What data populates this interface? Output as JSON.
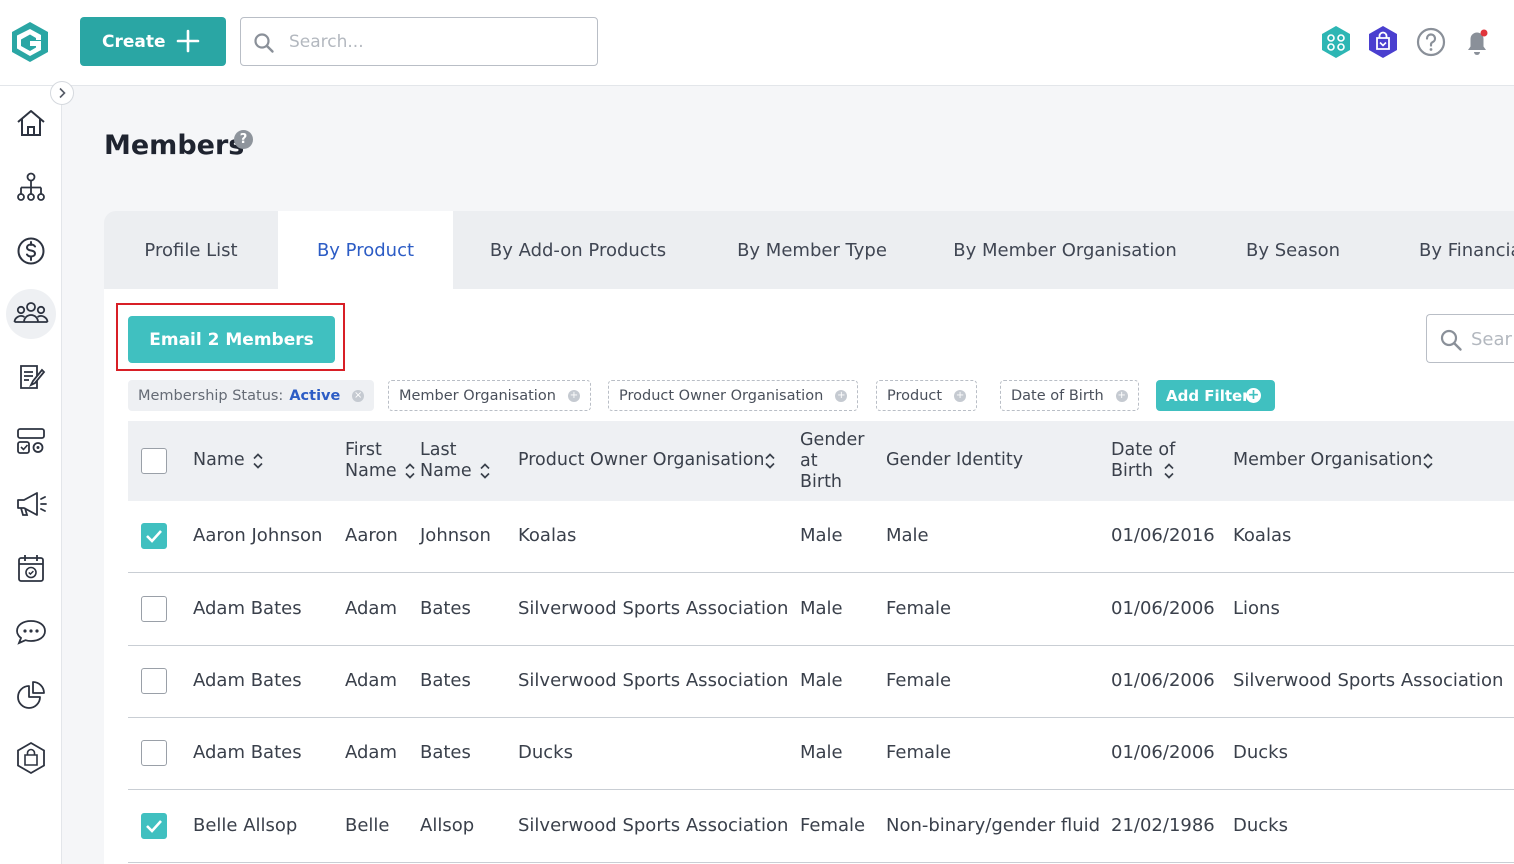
{
  "header": {
    "create_label": "Create",
    "search_placeholder": "Search..."
  },
  "page": {
    "title": "Members",
    "help_symbol": "?"
  },
  "tabs": [
    {
      "label": "Profile List"
    },
    {
      "label": "By Product",
      "active": true
    },
    {
      "label": "By Add-on Products"
    },
    {
      "label": "By Member Type"
    },
    {
      "label": "By Member Organisation"
    },
    {
      "label": "By Season"
    },
    {
      "label": "By Financia"
    }
  ],
  "toolbar": {
    "email_label": "Email 2 Members",
    "search_placeholder": "Sear"
  },
  "filters": {
    "status_label": "Membership Status:",
    "status_value": "Active",
    "chips": [
      "Member Organisation",
      "Product Owner Organisation",
      "Product",
      "Date of Birth"
    ],
    "add_filter_label": "Add Filter"
  },
  "table": {
    "columns": [
      {
        "label": "Name"
      },
      {
        "label_l1": "First",
        "label_l2": "Name"
      },
      {
        "label_l1": "Last",
        "label_l2": "Name"
      },
      {
        "label": "Product Owner Organisation"
      },
      {
        "label_l1": "Gender",
        "label_l2": "at",
        "label_l3": "Birth"
      },
      {
        "label": "Gender Identity"
      },
      {
        "label_l1": "Date of",
        "label_l2": "Birth"
      },
      {
        "label": "Member Organisation"
      }
    ],
    "rows": [
      {
        "checked": true,
        "name": "Aaron Johnson",
        "first": "Aaron",
        "last": "Johnson",
        "poo": "Koalas",
        "gab": "Male",
        "gi": "Male",
        "dob": "01/06/2016",
        "mo": "Koalas"
      },
      {
        "checked": false,
        "name": "Adam Bates",
        "first": "Adam",
        "last": "Bates",
        "poo": "Silverwood Sports Association",
        "gab": "Male",
        "gi": "Female",
        "dob": "01/06/2006",
        "mo": "Lions"
      },
      {
        "checked": false,
        "name": "Adam Bates",
        "first": "Adam",
        "last": "Bates",
        "poo": "Silverwood Sports Association",
        "gab": "Male",
        "gi": "Female",
        "dob": "01/06/2006",
        "mo": "Silverwood Sports Association"
      },
      {
        "checked": false,
        "name": "Adam Bates",
        "first": "Adam",
        "last": "Bates",
        "poo": "Ducks",
        "gab": "Male",
        "gi": "Female",
        "dob": "01/06/2006",
        "mo": "Ducks"
      },
      {
        "checked": true,
        "name": "Belle Allsop",
        "first": "Belle",
        "last": "Allsop",
        "poo": "Silverwood Sports Association",
        "gab": "Female",
        "gi": "Non-binary/gender fluid",
        "dob": "21/02/1986",
        "mo": "Ducks"
      }
    ]
  },
  "colors": {
    "brand_teal": "#2aa6a4",
    "accent_teal": "#40c0c0",
    "active_tab_text": "#2c5cc5",
    "highlight_red": "#d81f26",
    "notification_dot": "#e0343b",
    "shop_icon": "#4a3fcf"
  },
  "icons": {
    "nav": [
      "home-icon",
      "org-chart-icon",
      "dollar-icon",
      "members-icon",
      "registration-form-icon",
      "competitions-icon",
      "announcements-icon",
      "calendar-icon",
      "chat-icon",
      "reports-icon",
      "shop-icon"
    ],
    "top": [
      "teams-hex-icon",
      "shop-hex-icon",
      "help-icon",
      "bell-icon"
    ]
  }
}
